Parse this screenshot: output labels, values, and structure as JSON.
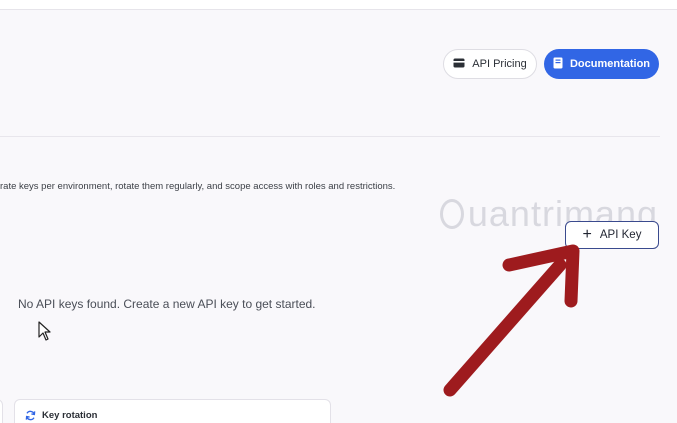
{
  "header": {
    "pricing_label": "API Pricing",
    "pricing_icon": "credit-card-icon",
    "docs_label": "Documentation",
    "docs_icon": "book-icon",
    "accent": "#3166e5"
  },
  "main": {
    "description": "rate keys per environment, rotate them regularly, and scope access with roles and restrictions.",
    "add_key_label": "API Key",
    "add_key_icon": "plus-icon",
    "empty_message": "No API keys found. Create a new API key to get started."
  },
  "watermark": {
    "text": "uantrimang"
  },
  "cards": {
    "rotation_title": "Key rotation",
    "rotation_icon": "refresh-icon"
  },
  "annotation": {
    "arrow_color": "#9e1b1e"
  }
}
